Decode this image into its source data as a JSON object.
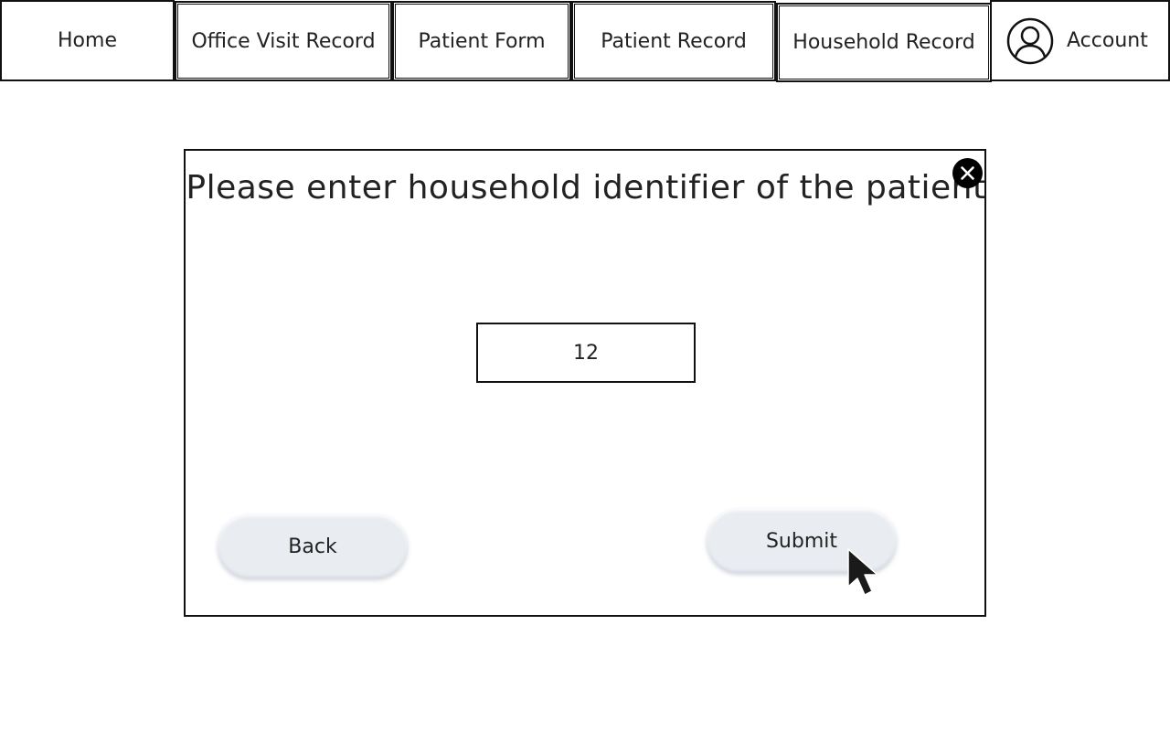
{
  "nav": {
    "home": "Home",
    "office_visit_record": "Office Visit Record",
    "patient_form": "Patient Form",
    "patient_record": "Patient Record",
    "household_record": "Household Record",
    "account": "Account",
    "account_icon": "user-circle-icon"
  },
  "dialog": {
    "title": "Please enter household identifier of the patient",
    "close_icon": "close-icon",
    "input_value": "12",
    "back_label": "Back",
    "submit_label": "Submit"
  },
  "colors": {
    "border": "#111111",
    "text": "#222222",
    "button_bg": "#e9edf2",
    "close_bg": "#000000"
  }
}
